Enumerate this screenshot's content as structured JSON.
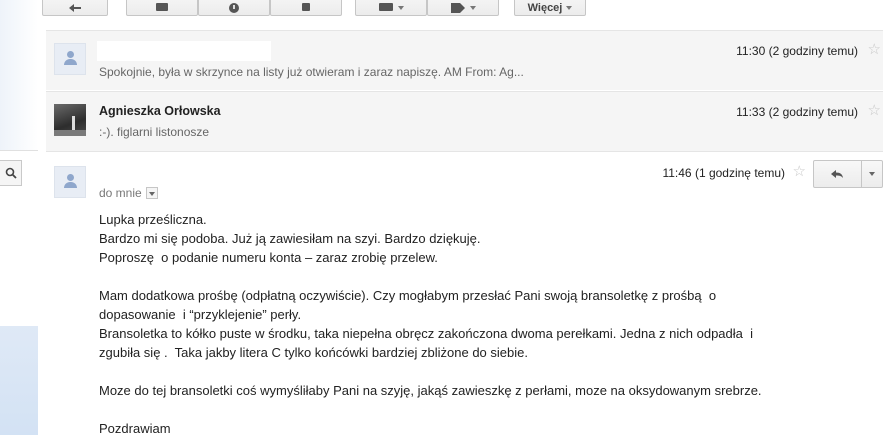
{
  "toolbar": {
    "buttons": [
      {
        "icon": "archive-icon"
      },
      {
        "icon": "report-spam-icon"
      },
      {
        "icon": "delete-icon"
      },
      {
        "icon": "labels-icon"
      },
      {
        "icon": "tag-icon"
      }
    ],
    "more_label": "Więcej"
  },
  "messages": [
    {
      "sender": "",
      "snippet": "Spokojnie, była w skrzynce na listy już otwieram i zaraz napiszę. AM From: Ag...",
      "time": "11:30 (2 godziny temu)"
    },
    {
      "sender": "Agnieszka Orłowska",
      "snippet": ":-). figlarni listonosze",
      "time": "11:33 (2 godziny temu)"
    }
  ],
  "open_message": {
    "time": "11:46 (1 godzinę temu)",
    "to": "do mnie",
    "body": [
      "Lupka prześliczna.",
      "Bardzo mi się podoba. Już ją zawiesiłam na szyi. Bardzo dziękuję.",
      "Poproszę  o podanie numeru konta – zaraz zrobię przelew.",
      "",
      "Mam dodatkowa prośbę (odpłatną oczywiście). Czy mogłabym przesłać Pani swoją bransoletkę z prośbą  o",
      "dopasowanie  i “przyklejenie” perły.",
      "Bransoletka to kółko puste w środku, taka niepełna obręcz zakończona dwoma perełkami. Jedna z nich odpadła  i",
      "zgubiła się .  Taka jakby litera C tylko końcówki bardziej zbliżone do siebie.",
      "",
      "Moze do tej bransoletki coś wymyśliłaby Pani na szyję, jakąś zawieszkę z perłami, moze na oksydowanym srebrze.",
      "",
      "Pozdrawiam"
    ]
  }
}
